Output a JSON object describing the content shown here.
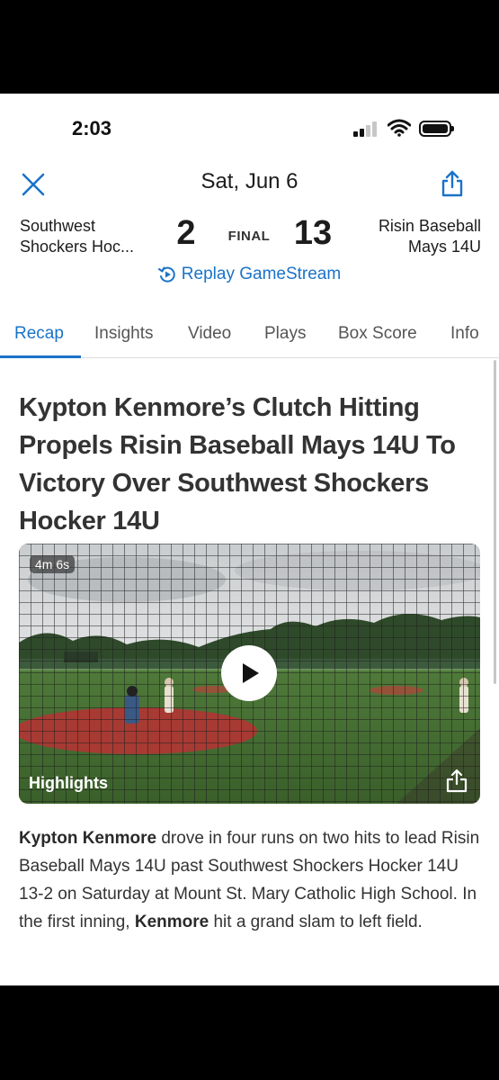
{
  "status_bar": {
    "time": "2:03"
  },
  "header": {
    "date": "Sat, Jun 6"
  },
  "game": {
    "home_team_line1": "Southwest",
    "home_team_line2": "Shockers Hoc...",
    "home_score": "2",
    "status": "FINAL",
    "away_score": "13",
    "away_team_line1": "Risin Baseball",
    "away_team_line2": "Mays 14U",
    "replay_label": "Replay GameStream"
  },
  "tabs": [
    "Recap",
    "Insights",
    "Video",
    "Plays",
    "Box Score",
    "Info"
  ],
  "active_tab": "Recap",
  "article": {
    "headline": "Kypton Kenmore’s Clutch Hitting Propels Risin Baseball Mays 14U To Victory Over Southwest Shockers Hocker 14U",
    "video_duration": "4m 6s",
    "video_label": "Highlights",
    "body_name_1": "Kypton Kenmore",
    "body_text_1": " drove in four runs on two hits to lead Risin Baseball Mays 14U past Southwest Shockers Hocker 14U 13-2 on Saturday at Mount St. Mary Catholic High School. In the first inning, ",
    "body_name_2": "Kenmore",
    "body_text_2": " hit a grand slam to left field."
  },
  "colors": {
    "accent": "#1a73c9",
    "text": "#333333"
  },
  "icons": [
    "close-icon",
    "share-icon",
    "replay-icon",
    "play-icon",
    "video-share-icon",
    "signal-icon",
    "wifi-icon",
    "battery-icon"
  ]
}
